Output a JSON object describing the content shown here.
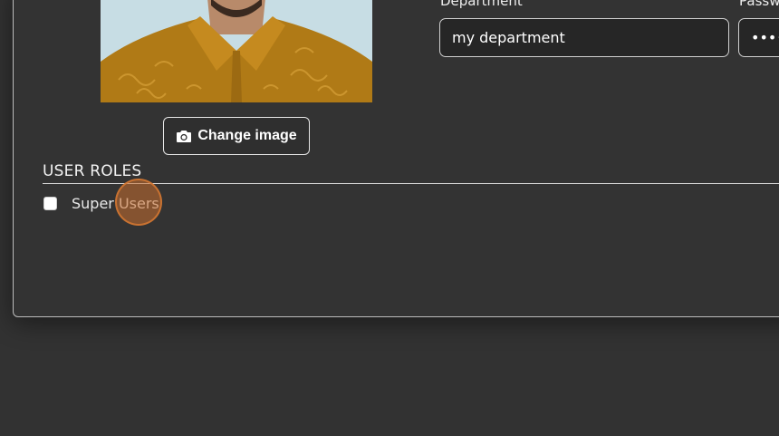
{
  "profile": {
    "change_image_label": "Change image"
  },
  "fields": {
    "department": {
      "label": "Department",
      "value": "my department"
    },
    "password": {
      "label": "Password",
      "value": "••••••••"
    }
  },
  "roles": {
    "section_title": "USER ROLES",
    "items": [
      {
        "label": "Super Users",
        "checked": false
      }
    ]
  },
  "icons": {
    "change_image": "camera-icon"
  },
  "colors": {
    "background": "#323232",
    "card_border": "#bdbdbd",
    "input_background": "#262626",
    "click_marker": "#c96e2d"
  }
}
